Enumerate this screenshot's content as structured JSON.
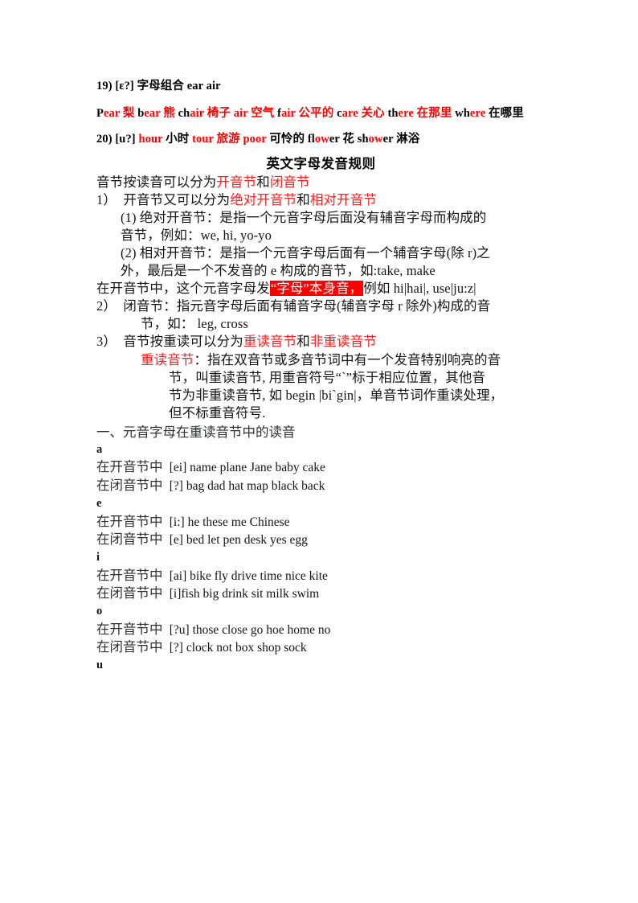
{
  "entries": [
    {
      "id": "entry-19",
      "segments": [
        {
          "t": "19) [ɛ?] 字母组合 ear air",
          "c": "blk"
        }
      ]
    },
    {
      "id": "entry-19-words",
      "segments": [
        {
          "t": "P",
          "c": "blk"
        },
        {
          "t": "ear ",
          "c": "red"
        },
        {
          "t": "梨",
          "c": "red"
        },
        {
          "t": "  b",
          "c": "blk"
        },
        {
          "t": "ear ",
          "c": "red"
        },
        {
          "t": "熊",
          "c": "red"
        },
        {
          "t": "  ch",
          "c": "blk"
        },
        {
          "t": "air ",
          "c": "red"
        },
        {
          "t": "椅子",
          "c": "red"
        },
        {
          "t": "  ",
          "c": "blk"
        },
        {
          "t": "air ",
          "c": "red"
        },
        {
          "t": "空气",
          "c": "red"
        },
        {
          "t": "  f",
          "c": "blk"
        },
        {
          "t": "air ",
          "c": "red"
        },
        {
          "t": "公平的",
          "c": "red"
        },
        {
          "t": "  c",
          "c": "blk"
        },
        {
          "t": "are ",
          "c": "red"
        },
        {
          "t": "关心",
          "c": "red"
        },
        {
          "t": "  th",
          "c": "blk"
        },
        {
          "t": "ere ",
          "c": "red"
        },
        {
          "t": "在那里",
          "c": "red"
        },
        {
          "t": "  wh",
          "c": "blk"
        },
        {
          "t": "ere",
          "c": "red"
        },
        {
          "t": " 在哪里",
          "c": "blk"
        }
      ]
    },
    {
      "id": "entry-20",
      "segments": [
        {
          "t": "20) [u?] ",
          "c": "blk"
        },
        {
          "t": "hour ",
          "c": "red"
        },
        {
          "t": "小时",
          "c": "blk"
        },
        {
          "t": "  ",
          "c": "blk"
        },
        {
          "t": "tour ",
          "c": "red"
        },
        {
          "t": "旅游",
          "c": "red"
        },
        {
          "t": "  ",
          "c": "blk"
        },
        {
          "t": "poor",
          "c": "red"
        },
        {
          "t": " 可怜的 ",
          "c": "blk"
        },
        {
          "t": "fl",
          "c": "blk"
        },
        {
          "t": "ow",
          "c": "red"
        },
        {
          "t": "er ",
          "c": "blk"
        },
        {
          "t": "花",
          "c": "blk"
        },
        {
          "t": "  sh",
          "c": "blk"
        },
        {
          "t": "ow",
          "c": "red"
        },
        {
          "t": "er ",
          "c": "blk"
        },
        {
          "t": "淋浴",
          "c": "blk"
        }
      ]
    }
  ],
  "title": "英文字母发音规则",
  "rules": [
    {
      "id": "rule-syllable-types",
      "indent": 0,
      "segments": [
        {
          "t": "音节按读音可以分为",
          "c": "k"
        },
        {
          "t": "开音节",
          "c": "r"
        },
        {
          "t": "和",
          "c": "k"
        },
        {
          "t": "闭音节",
          "c": "r"
        }
      ]
    },
    {
      "id": "rule-1-open",
      "indent": 0,
      "segments": [
        {
          "t": "1）  开音节又可以分为",
          "c": "k"
        },
        {
          "t": "绝对开音节",
          "c": "r"
        },
        {
          "t": "和",
          "c": "k"
        },
        {
          "t": "相对开音节",
          "c": "r"
        }
      ]
    },
    {
      "id": "rule-1-1-absolute",
      "indent": 1,
      "segments": [
        {
          "t": "(1) 绝对开音节：是指一个元音字母后面没有辅音字母而构成的",
          "c": "k"
        }
      ]
    },
    {
      "id": "rule-1-1-absolute-cont",
      "indent": 1,
      "segments": [
        {
          "t": "音节，例如：we, hi, yo-yo",
          "c": "k"
        }
      ]
    },
    {
      "id": "rule-1-2-relative",
      "indent": 1,
      "segments": [
        {
          "t": "(2) 相对开音节：是指一个元音字母后面有一个辅音字母(除 r)之",
          "c": "k"
        }
      ]
    },
    {
      "id": "rule-1-2-relative-cont",
      "indent": 1,
      "segments": [
        {
          "t": "外，最后是一个不发音的 e 构成的音节，如:take, make",
          "c": "k"
        }
      ]
    },
    {
      "id": "rule-open-letter-sound",
      "indent": 0,
      "segments": [
        {
          "t": "在开音节中，这个元音字母发",
          "c": "k"
        },
        {
          "t": "“字母”本身音，",
          "c": "hl"
        },
        {
          "t": "例如 hi|hai|, use|ju:z|",
          "c": "k"
        }
      ]
    },
    {
      "id": "rule-2-closed",
      "indent": 0,
      "segments": [
        {
          "t": "2）  闭音节：指元音字母后面有辅音字母(辅音字母 r 除外)构成的音",
          "c": "k"
        }
      ]
    },
    {
      "id": "rule-2-closed-cont",
      "indent": 2,
      "segments": [
        {
          "t": "节，如： leg, cross",
          "c": "k"
        }
      ]
    },
    {
      "id": "rule-3-stress",
      "indent": 0,
      "segments": [
        {
          "t": "3）  音节按重读可以分为",
          "c": "k"
        },
        {
          "t": "重读音节",
          "c": "r"
        },
        {
          "t": "和",
          "c": "k"
        },
        {
          "t": "非重读音节",
          "c": "r"
        }
      ]
    },
    {
      "id": "rule-3-stress-def",
      "indent": 2,
      "segments": [
        {
          "t": "重读音节",
          "c": "r"
        },
        {
          "t": "：指在双音节或多音节词中有一个发音特别响亮的音",
          "c": "k"
        }
      ]
    },
    {
      "id": "rule-3-stress-def-l2",
      "indent": 3,
      "segments": [
        {
          "t": "节，叫重读音节, 用重音符号“`”标于相应位置，其他音",
          "c": "k"
        }
      ]
    },
    {
      "id": "rule-3-stress-def-l3",
      "indent": 3,
      "segments": [
        {
          "t": "节为非重读音节, 如 begin |bi`gin|，单音节词作重读处理，",
          "c": "k"
        }
      ]
    },
    {
      "id": "rule-3-stress-def-l4",
      "indent": 3,
      "segments": [
        {
          "t": "但不标重音符号.",
          "c": "k"
        }
      ]
    }
  ],
  "section_heading": "一、元音字母在重读音节中的读音",
  "vowels": [
    {
      "letter": "a",
      "lines": [
        {
          "label": "在开音节中",
          "phonetic": "[ei]",
          "words": "name plane Jane baby cake"
        },
        {
          "label": "在闭音节中",
          "phonetic": "[?]",
          "words": "bag dad hat map black back"
        }
      ]
    },
    {
      "letter": "e",
      "lines": [
        {
          "label": "在开音节中",
          "phonetic": "[i:]",
          "words": "he these me Chinese"
        },
        {
          "label": "在闭音节中",
          "phonetic": "[e]",
          "words": "bed let pen desk yes egg"
        }
      ]
    },
    {
      "letter": "i",
      "lines": [
        {
          "label": "在开音节中",
          "phonetic": "[ai]",
          "words": "bike fly drive time nice kite"
        },
        {
          "label": "在闭音节中",
          "phonetic": "[i]",
          "words": "fish big drink sit milk swim",
          "tight": true
        }
      ]
    },
    {
      "letter": "o",
      "lines": [
        {
          "label": "在开音节中",
          "phonetic": "[?u]",
          "words": "those close go hoe home no"
        },
        {
          "label": "在闭音节中",
          "phonetic": "[?]",
          "words": "clock not box shop sock"
        }
      ]
    },
    {
      "letter": "u",
      "lines": []
    }
  ]
}
